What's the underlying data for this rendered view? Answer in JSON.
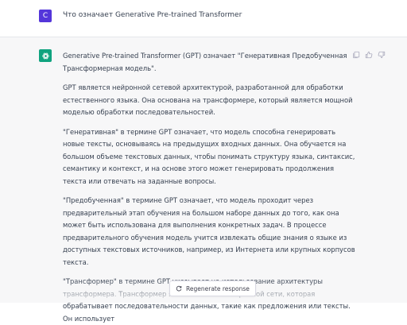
{
  "user_message": {
    "avatar_letter": "C",
    "avatar_color": "#5436da",
    "text": "Что означает Generative Pre-trained Transformer"
  },
  "assistant_message": {
    "avatar_color": "#10a37f",
    "avatar_icon": "openai-logo-icon",
    "paragraphs": [
      "Generative Pre-trained Transformer (GPT) означает \"Генеративная Предобученная Трансформерная модель\".",
      "GPT является нейронной сетевой архитектурой, разработанной для обработки естественного языка. Она основана на трансформере, который является мощной моделью обработки последовательностей.",
      "\"Генеративная\" в термине GPT означает, что модель способна генерировать новые тексты, основываясь на предыдущих входных данных. Она обучается на большом объеме текстовых данных, чтобы понимать структуру языка, синтаксис, семантику и контекст, и на основе этого может генерировать продолжения текста или отвечать на заданные вопросы.",
      "\"Предобученная\" в термине GPT означает, что модель проходит через предварительный этап обучения на большом наборе данных до того, как она может быть использована для выполнения конкретных задач. В процессе предварительного обучения модель учится извлекать общие знания о языке из доступных текстовых источников, например, из Интернета или крупных корпусов текста.",
      "\"Трансформер\" в термине GPT указывает на использование архитектуры трансформера. Трансформер является типом нейронной сети, которая обрабатывает последовательности данных, такие как предложения или тексты. Он использует"
    ],
    "action_icons": [
      "copy-icon",
      "thumbs-up-icon",
      "thumbs-down-icon"
    ]
  },
  "regenerate": {
    "label": "Regenerate response",
    "icon": "refresh-icon"
  }
}
